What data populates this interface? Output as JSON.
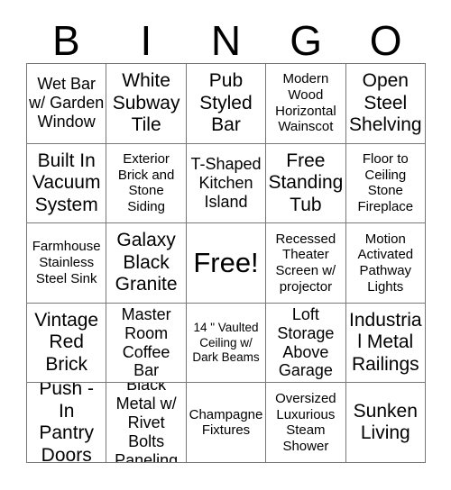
{
  "card": {
    "title": "BINGO",
    "header_letters": [
      "B",
      "I",
      "N",
      "G",
      "O"
    ],
    "free_space_label": "Free!",
    "grid_line_color": "#777777",
    "text_color": "#000000",
    "background_color": "#ffffff",
    "columns": [
      {
        "letter": "B",
        "cells": [
          "Wet Bar w/ Garden Window",
          "Built In Vacuum System",
          "Farmhouse Stainless Steel Sink",
          "Vintage Red Brick",
          "Push - In Pantry Doors"
        ]
      },
      {
        "letter": "I",
        "cells": [
          "White Subway Tile",
          "Exterior Brick and Stone Siding",
          "Galaxy Black Granite",
          "Master Room Coffee Bar",
          "Black Metal w/ Rivet Bolts Paneling"
        ]
      },
      {
        "letter": "N",
        "cells": [
          "Pub Styled Bar",
          "T-Shaped Kitchen Island",
          "Free!",
          "14 \" Vaulted Ceiling w/ Dark Beams",
          "Champagne Fixtures"
        ]
      },
      {
        "letter": "G",
        "cells": [
          "Modern Wood Horizontal Wainscot",
          "Free Standing Tub",
          "Recessed Theater Screen w/ projector",
          "Loft Storage Above Garage",
          "Oversized Luxurious Steam Shower"
        ]
      },
      {
        "letter": "O",
        "cells": [
          "Open Steel Shelving",
          "Floor to Ceiling Stone Fireplace",
          "Motion Activated Pathway Lights",
          "Industrial Metal Railings",
          "Sunken Living"
        ]
      }
    ],
    "rows": [
      [
        "Wet Bar w/ Garden Window",
        "White Subway Tile",
        "Pub Styled Bar",
        "Modern Wood Horizontal Wainscot",
        "Open Steel Shelving"
      ],
      [
        "Built In Vacuum System",
        "Exterior Brick and Stone Siding",
        "T-Shaped Kitchen Island",
        "Free Standing Tub",
        "Floor to Ceiling Stone Fireplace"
      ],
      [
        "Farmhouse Stainless Steel Sink",
        "Galaxy Black Granite",
        "Free!",
        "Recessed Theater Screen w/ projector",
        "Motion Activated Pathway Lights"
      ],
      [
        "Vintage Red Brick",
        "Master Room Coffee Bar",
        "14 \" Vaulted Ceiling w/ Dark Beams",
        "Loft Storage Above Garage",
        "Industrial Metal Railings"
      ],
      [
        "Push - In Pantry Doors",
        "Black Metal w/ Rivet Bolts Paneling",
        "Champagne Fixtures",
        "Oversized Luxurious Steam Shower",
        "Sunken Living"
      ]
    ],
    "cell_sizes": [
      [
        "md",
        "lg",
        "lg",
        "sm",
        "lg"
      ],
      [
        "lg",
        "sm",
        "md",
        "lg",
        "sm"
      ],
      [
        "sm",
        "lg",
        "xl",
        "sm",
        "sm"
      ],
      [
        "lg",
        "md",
        "xs",
        "md",
        "lg"
      ],
      [
        "lg",
        "md",
        "sm",
        "sm",
        "lg"
      ]
    ]
  }
}
